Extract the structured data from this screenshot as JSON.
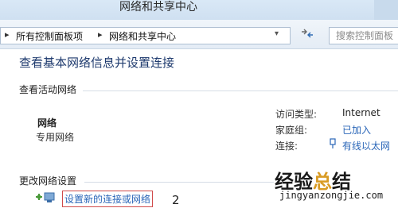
{
  "window": {
    "title": "网络和共享中心"
  },
  "address_bar": {
    "breadcrumbs": [
      {
        "label": "所有控制面板项"
      },
      {
        "label": "网络和共享中心"
      }
    ],
    "search_placeholder": "搜索控制面板"
  },
  "icons": {
    "back": "chevron-right-icon",
    "crumb_separator": "chevron-right-icon",
    "dropdown": "chevron-down-icon",
    "refresh": "refresh-icon",
    "connection": "ethernet-icon",
    "setup": "network-add-icon"
  },
  "main": {
    "title": "查看基本网络信息并设置连接",
    "active_section_label": "查看活动网络",
    "network": {
      "name": "网络",
      "type": "专用网络"
    },
    "details": [
      {
        "key": "访问类型:",
        "value": "Internet"
      },
      {
        "key": "家庭组:",
        "value": "已加入"
      },
      {
        "key": "连接:",
        "value": "有线以太网"
      }
    ],
    "change_section_label": "更改网络设置",
    "setup_link": "设置新的连接或网络",
    "step_number": "2"
  },
  "watermark": {
    "brand_part1": "经验",
    "brand_part2": "总",
    "brand_part3": "结",
    "url": "jingyanzongjie.com"
  },
  "colors": {
    "link": "#2a66b8",
    "title": "#1e3a6e",
    "highlight_border": "#d04a4a",
    "watermark_accent": "#d99b23"
  }
}
